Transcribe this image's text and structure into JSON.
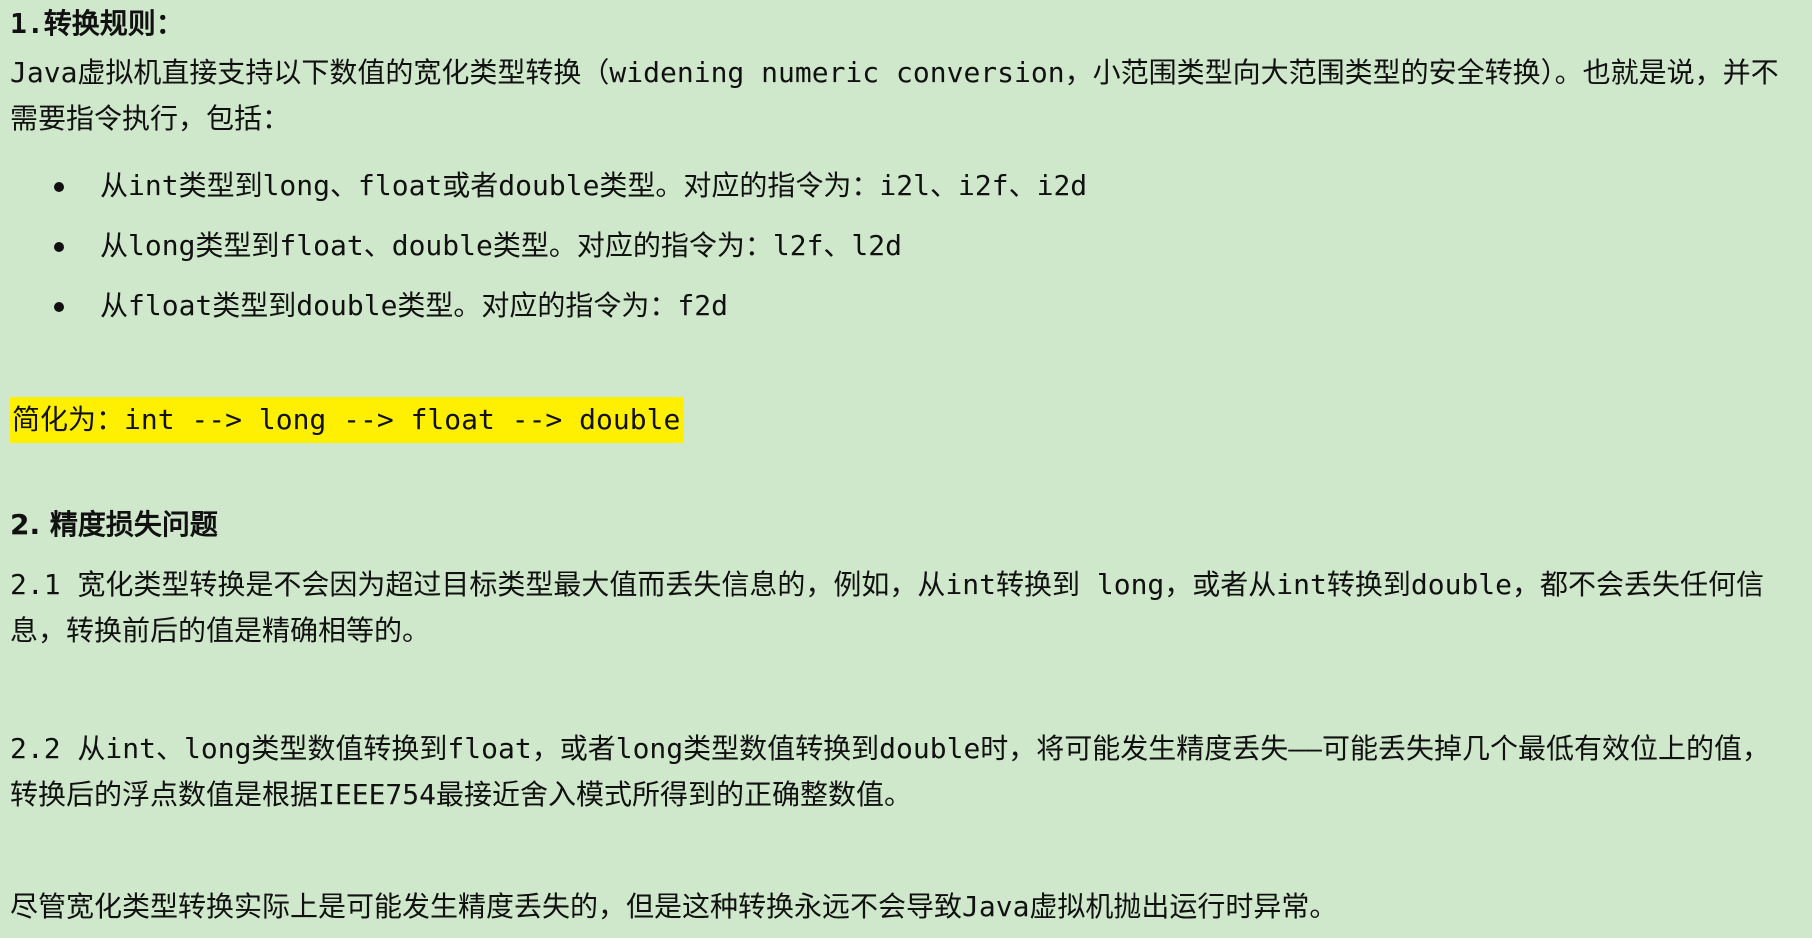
{
  "section1": {
    "heading": "1.转换规则：",
    "intro": "Java虚拟机直接支持以下数值的宽化类型转换（widening numeric conversion，小范围类型向大范围类型的安全转换）。也就是说，并不需要指令执行，包括：",
    "bullets": [
      "从int类型到long、float或者double类型。对应的指令为：i2l、i2f、i2d",
      "从long类型到float、double类型。对应的指令为：l2f、l2d",
      "从float类型到double类型。对应的指令为：f2d"
    ],
    "simplified": "简化为：int --> long --> float --> double"
  },
  "section2": {
    "heading": "2. 精度损失问题",
    "p21": "2.1 宽化类型转换是不会因为超过目标类型最大值而丢失信息的，例如，从int转换到 long，或者从int转换到double，都不会丢失任何信息，转换前后的值是精确相等的。",
    "p22": "2.2 从int、long类型数值转换到float，或者long类型数值转换到double时，将可能发生精度丢失——可能丢失掉几个最低有效位上的值，转换后的浮点数值是根据IEEE754最接近舍入模式所得到的正确整数值。",
    "note": "尽管宽化类型转换实际上是可能发生精度丢失的，但是这种转换永远不会导致Java虚拟机抛出运行时异常。"
  }
}
